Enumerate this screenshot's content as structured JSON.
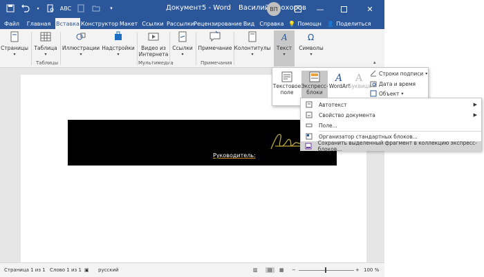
{
  "window": {
    "title": "Документ5 - Word",
    "user": "Василий Прохоров",
    "avatar_initials": "ВП"
  },
  "tabs": [
    "Файл",
    "Главная",
    "Вставка",
    "Конструктор",
    "Макет",
    "Ссылки",
    "Рассылки",
    "Рецензирование",
    "Вид",
    "Справка",
    "Помощн",
    "Поделиться"
  ],
  "active_tab": "Вставка",
  "ribbon": {
    "pages": "Страницы",
    "table": "Таблица",
    "tables_group": "Таблицы",
    "illustrations": "Иллюстрации",
    "addins": "Надстройки",
    "online_video_line1": "Видео из",
    "online_video_line2": "Интернета",
    "media_group": "Мультимедиа",
    "links": "Ссылки",
    "comment": "Примечание",
    "comments_group": "Примечания",
    "header_footer": "Колонтитулы",
    "text": "Текст",
    "symbols": "Символы"
  },
  "text_gallery": {
    "textbox_line1": "Текстовое",
    "textbox_line2": "поле",
    "quickparts_line1": "Экспресс-",
    "quickparts_line2": "блоки",
    "wordart": "WordArt",
    "dropcap": "Буквица",
    "signature_line": "Строки подписи",
    "date_time": "Дата и время",
    "object": "Объект"
  },
  "quickparts_menu": [
    {
      "label": "Автотекст",
      "submenu": true
    },
    {
      "label": "Свойство документа",
      "submenu": true
    },
    {
      "label": "Поле...",
      "submenu": false
    },
    {
      "label": "Организатор стандартных блоков...",
      "submenu": false
    },
    {
      "label": "Сохранить выделенный фрагмент в коллекцию экспресс-блоков...",
      "submenu": false
    }
  ],
  "document": {
    "signature_label": "Руководитель:"
  },
  "status": {
    "page": "Страница 1 из 1",
    "words": "Слово 1 из 1",
    "language": "русский",
    "zoom": "100 %"
  }
}
